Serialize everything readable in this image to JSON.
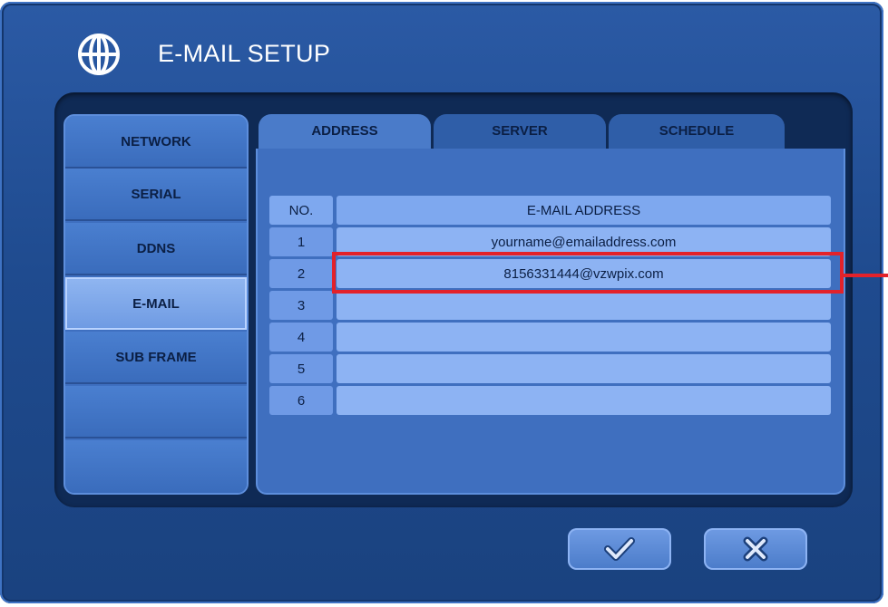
{
  "window": {
    "title": "E-MAIL SETUP",
    "icon": "globe-icon"
  },
  "sidebar": {
    "items": [
      {
        "label": "NETWORK"
      },
      {
        "label": "SERIAL"
      },
      {
        "label": "DDNS"
      },
      {
        "label": "E-MAIL",
        "active": true
      },
      {
        "label": "SUB FRAME"
      },
      {
        "label": ""
      },
      {
        "label": ""
      }
    ]
  },
  "tabs": [
    {
      "label": "ADDRESS",
      "active": true
    },
    {
      "label": "SERVER"
    },
    {
      "label": "SCHEDULE"
    }
  ],
  "table": {
    "headers": [
      "NO.",
      "E-MAIL ADDRESS"
    ],
    "rows": [
      {
        "no": "1",
        "address": "yourname@emailaddress.com"
      },
      {
        "no": "2",
        "address": "8156331444@vzwpix.com"
      },
      {
        "no": "3",
        "address": ""
      },
      {
        "no": "4",
        "address": ""
      },
      {
        "no": "5",
        "address": ""
      },
      {
        "no": "6",
        "address": ""
      }
    ]
  },
  "buttons": {
    "confirm_icon": "checkmark-icon",
    "cancel_icon": "close-icon"
  },
  "colors": {
    "highlight": "#e3222a",
    "accent": "#3f6fbf"
  }
}
